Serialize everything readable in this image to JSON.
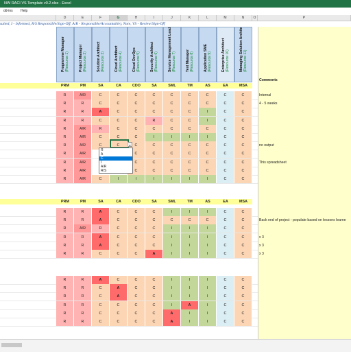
{
  "window": {
    "title": "NW RACI VS Template v0.2.xlsx  -  Excel"
  },
  "menu": {
    "items": [
      "dd-ins",
      "Help"
    ]
  },
  "columns": [
    "D",
    "E",
    "F",
    "G",
    "H",
    "I",
    "J",
    "K",
    "L",
    "M",
    "N",
    "O",
    "P"
  ],
  "legend": "sulted, I - Informed, R/S  Responsible/Sign-Off, A/R - Responsible/Accountable), Note, VS - Review/Sign-Off",
  "roles": [
    {
      "name": "Programme Manager",
      "res": "(Resource 1)",
      "abbr": "PRM"
    },
    {
      "name": "Project Manager",
      "res": "(Resource 2)",
      "abbr": "PM"
    },
    {
      "name": "Solution Architect",
      "res": "(Resource 3)",
      "abbr": "SA"
    },
    {
      "name": "Cloud Architect",
      "res": "(Resource 4)",
      "abbr": "CA"
    },
    {
      "name": "Cloud DevOps",
      "res": "(Resource 5)",
      "abbr": "CDO"
    },
    {
      "name": "Security Architect",
      "res": "(Resource 6)",
      "abbr": "SA"
    },
    {
      "name": "Service Management Lead",
      "res": "(Resource 7)",
      "abbr": "SML"
    },
    {
      "name": "Test Manager",
      "res": "(Resource 8)",
      "abbr": "TM"
    },
    {
      "name": "Application SME",
      "res": "(Resource 9)",
      "abbr": "AS"
    },
    {
      "name": "Enterprise Architect",
      "res": "(Resource 10)",
      "abbr": "EA"
    },
    {
      "name": "Managing Solution Architect",
      "res": "(Resource 11)",
      "abbr": "MSA"
    }
  ],
  "comments_header": "Comments",
  "dropdown": {
    "options": [
      "R",
      "A",
      "C",
      "I",
      "A/R",
      "R/S"
    ],
    "selected": "C"
  },
  "section1": {
    "rows": [
      {
        "cells": [
          "R",
          "A/R",
          "C",
          "C",
          "C",
          "C",
          "C",
          "C",
          "C",
          "C",
          "C"
        ],
        "comment": "Internal"
      },
      {
        "cells": [
          "R",
          "R",
          "C",
          "C",
          "C",
          "C",
          "C",
          "C",
          "C",
          "C",
          "C"
        ],
        "comment": "4 - 5 weeks"
      },
      {
        "cells": [
          "R",
          "R",
          "A",
          "C",
          "C",
          "C",
          "C",
          "C",
          "I",
          "C",
          "C"
        ],
        "comment": ""
      },
      {
        "cells": [
          "R",
          "R",
          "C",
          "C",
          "C",
          "R",
          "C",
          "C",
          "I",
          "C",
          "C"
        ],
        "comment": ""
      },
      {
        "cells": [
          "R",
          "A/R",
          "R",
          "C",
          "C",
          "C",
          "C",
          "C",
          "C",
          "C",
          "C"
        ],
        "comment": ""
      },
      {
        "cells": [
          "R",
          "A/R",
          "C",
          "C",
          "C",
          "I",
          "I",
          "I",
          "I",
          "C",
          "C"
        ],
        "comment": ""
      },
      {
        "cells": [
          "R",
          "A/R",
          "C",
          "C",
          "C",
          "C",
          "C",
          "C",
          "C",
          "C",
          "C"
        ],
        "comment": "no output"
      },
      {
        "cells": [
          "R",
          "A/R",
          "",
          "",
          "C",
          "C",
          "C",
          "C",
          "C",
          "C",
          "C"
        ],
        "comment": ""
      },
      {
        "cells": [
          "R",
          "A/R",
          "",
          "",
          "C",
          "C",
          "C",
          "C",
          "C",
          "C",
          "C"
        ],
        "comment": "This spreadsheet"
      },
      {
        "cells": [
          "R",
          "A/R",
          "",
          "",
          "C",
          "C",
          "C",
          "C",
          "C",
          "C",
          "C"
        ],
        "comment": ""
      },
      {
        "cells": [
          "R",
          "A/R",
          "C",
          "I",
          "I",
          "I",
          "I",
          "I",
          "I",
          "C",
          "C"
        ],
        "comment": ""
      }
    ]
  },
  "section2": {
    "rows": [
      {
        "cells": [
          "R",
          "R",
          "A",
          "C",
          "C",
          "C",
          "I",
          "I",
          "I",
          "C",
          "C"
        ],
        "comment": ""
      },
      {
        "cells": [
          "R",
          "R",
          "A",
          "C",
          "C",
          "C",
          "C",
          "C",
          "C",
          "C",
          "C"
        ],
        "comment": "Back end of project - populate based on lessons learne"
      },
      {
        "cells": [
          "R",
          "A/R",
          "R",
          "C",
          "C",
          "C",
          "I",
          "I",
          "I",
          "C",
          "C"
        ],
        "comment": ""
      },
      {
        "cells": [
          "R",
          "R",
          "A",
          "C",
          "C",
          "C",
          "I",
          "I",
          "I",
          "C",
          "C"
        ],
        "comment": "x 3"
      },
      {
        "cells": [
          "R",
          "R",
          "A",
          "C",
          "C",
          "C",
          "I",
          "I",
          "I",
          "C",
          "C"
        ],
        "comment": "x 3"
      },
      {
        "cells": [
          "R",
          "R",
          "C",
          "C",
          "C",
          "A",
          "I",
          "I",
          "I",
          "C",
          "C"
        ],
        "comment": "x 3"
      }
    ]
  },
  "section3": {
    "rows": [
      {
        "cells": [
          "R",
          "R",
          "A",
          "C",
          "C",
          "C",
          "I",
          "I",
          "I",
          "C",
          "C"
        ],
        "comment": ""
      },
      {
        "cells": [
          "R",
          "R",
          "C",
          "A",
          "C",
          "C",
          "I",
          "I",
          "I",
          "C",
          "C"
        ],
        "comment": ""
      },
      {
        "cells": [
          "R",
          "R",
          "C",
          "A",
          "C",
          "C",
          "I",
          "I",
          "I",
          "C",
          "C"
        ],
        "comment": ""
      },
      {
        "cells": [
          "R",
          "R",
          "C",
          "C",
          "C",
          "C",
          "I",
          "A",
          "I",
          "C",
          "C"
        ],
        "comment": ""
      },
      {
        "cells": [
          "R",
          "R",
          "C",
          "C",
          "C",
          "C",
          "A",
          "I",
          "I",
          "C",
          "C"
        ],
        "comment": ""
      },
      {
        "cells": [
          "R",
          "R",
          "C",
          "C",
          "C",
          "C",
          "A",
          "I",
          "I",
          "C",
          "C"
        ],
        "comment": ""
      }
    ]
  },
  "colors": {
    "R": "#ffb3b3",
    "A": "#ff6b6b",
    "AR": "#ff9999",
    "C": "#fcd5b4",
    "I": "#c4d79b",
    "ea": "#daeef3",
    "header_blue": "#c5d9f1",
    "yellow": "#ffff99",
    "comment_bg": "#ffffcc",
    "excel_green": "#217346"
  }
}
